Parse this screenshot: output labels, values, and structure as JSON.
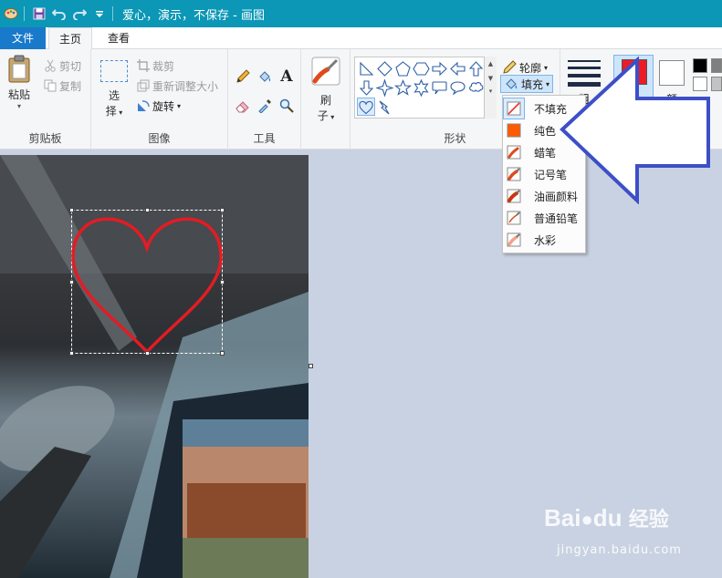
{
  "window": {
    "title": "爱心，演示，不保存 - 画图",
    "quick_access": [
      "app-menu-icon",
      "save-icon",
      "undo-icon",
      "redo-icon",
      "customize-icon"
    ]
  },
  "tabs": {
    "file": "文件",
    "home": "主页",
    "view": "查看"
  },
  "ribbon": {
    "clipboard": {
      "label": "剪贴板",
      "paste": "粘贴",
      "cut": "剪切",
      "copy": "复制"
    },
    "image": {
      "label": "图像",
      "select_1": "选",
      "select_2": "择",
      "crop": "裁剪",
      "resize": "重新调整大小",
      "rotate": "旋转"
    },
    "tools": {
      "label": "工具",
      "text_tool": "A"
    },
    "brushes": {
      "label_1": "刷",
      "label_2": "子"
    },
    "shapes": {
      "label": "形状",
      "outline": "轮廓",
      "fill": "填充"
    },
    "size": {
      "label_partial": "粗"
    },
    "colors": {
      "color1_label_partial": "颜",
      "color1": "#ed1c24",
      "color2": "#ffffff"
    }
  },
  "fill_menu": {
    "items": [
      {
        "label": "不填充",
        "icon": "no-fill-icon"
      },
      {
        "label": "纯色",
        "icon": "solid-color-icon"
      },
      {
        "label": "蜡笔",
        "icon": "crayon-icon"
      },
      {
        "label": "记号笔",
        "icon": "marker-icon"
      },
      {
        "label": "油画颜料",
        "icon": "oil-paint-icon"
      },
      {
        "label": "普通铅笔",
        "icon": "pencil-icon"
      },
      {
        "label": "水彩",
        "icon": "watercolor-icon"
      }
    ],
    "selected": "不填充",
    "solid_swatch_color": "#ff5a00"
  },
  "annotation": {
    "arrow_color": "#3d4fc7",
    "points_to": "纯色"
  },
  "canvas": {
    "heart_color": "#e31c23"
  },
  "watermark": {
    "brand_1": "Bai",
    "brand_2": "du",
    "brand_cn": "经验",
    "url": "jingyan.baidu.com"
  }
}
